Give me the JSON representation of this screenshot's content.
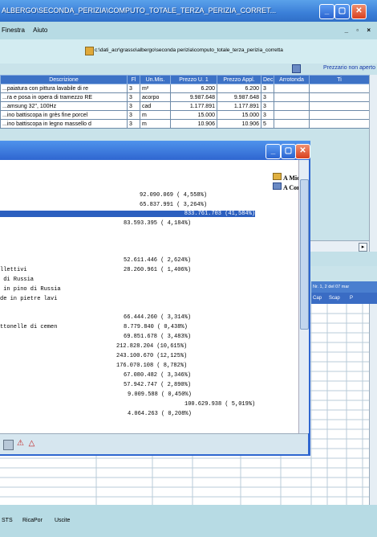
{
  "window": {
    "title": "ALBERGO\\SECONDA_PERIZIA\\COMPUTO_TOTALE_TERZA_PERIZIA_CORRET...",
    "min_label": "_",
    "max_label": "▢",
    "close_label": "✕"
  },
  "menu": {
    "items": [
      "Finestra",
      "Aiuto"
    ],
    "mdi_controls": "_ ▫ ×"
  },
  "path": "c:\\dati_acr\\grasso\\albergo\\seconda perizia\\computo_totale_terza_perizia_corretta",
  "link": "Prezzario non aperto",
  "table": {
    "headers": [
      "Descrizione",
      "Fl",
      "Un.Mis.",
      "Prezzo U. 1",
      "Prezzo Appl.",
      "Dec",
      "Arrotonda",
      "Ti"
    ],
    "rows": [
      [
        "...paiatura con pittura lavabile di re",
        "3",
        "m²",
        "6.200",
        "6.200",
        "3",
        "",
        ""
      ],
      [
        "...ra e posa in opera di tramezzo RE",
        "3",
        "acorpo",
        "9.987.648",
        "9.987.648",
        "3",
        "",
        ""
      ],
      [
        "...amsung 32\", 100Hz",
        "3",
        "cad",
        "1.177.891",
        "1.177.891",
        "3",
        "",
        ""
      ],
      [
        "...ino battiscopa in grès fine porcel",
        "3",
        "m",
        "15.000",
        "15.000",
        "3",
        "",
        ""
      ],
      [
        "...ino battiscopa in legno massello d",
        "3",
        "m",
        "10.906",
        "10.906",
        "5",
        "",
        ""
      ]
    ]
  },
  "popup": {
    "side_items": [
      "A Mico",
      "A Com"
    ],
    "lines": [
      {
        "label": "",
        "value": "92.090.069 ( 4,558%)"
      },
      {
        "label": "",
        "value": "65.837.991 ( 3,264%)"
      },
      {
        "label": "",
        "value": "833.761.703 (41,584%)",
        "selected": true
      },
      {
        "label": "",
        "value": "83.593.395 ( 4,184%)"
      },
      {
        "label": "",
        "value": ""
      },
      {
        "label": "",
        "value": ""
      },
      {
        "label": "",
        "value": "52.611.446 ( 2,624%)"
      },
      {
        "label": "llettivi",
        "value": "28.260.961 ( 1,406%)"
      },
      {
        "label": " di Russia",
        "value": ""
      },
      {
        "label": " in pino di Russia",
        "value": ""
      },
      {
        "label": "de in pietre lavi",
        "value": ""
      },
      {
        "label": "",
        "value": ""
      },
      {
        "label": "",
        "value": "66.444.260 ( 3,314%)"
      },
      {
        "label": "ttonelle di cemen",
        "value": "8.779.840 ( 0,438%)"
      },
      {
        "label": "",
        "value": "69.851.678 ( 3,483%)"
      },
      {
        "label": "",
        "value": "212.828.204 (10,615%)"
      },
      {
        "label": "",
        "value": "243.100.670 (12,125%)"
      },
      {
        "label": "",
        "value": "176.070.108 ( 8,782%)"
      },
      {
        "label": "",
        "value": "67.080.482 ( 3,346%)"
      },
      {
        "label": "",
        "value": "57.942.747 ( 2,890%)"
      },
      {
        "label": "",
        "value": "9.009.588 ( 0,450%)"
      },
      {
        "label": "",
        "value": "100.629.938 ( 5,019%)"
      },
      {
        "label": "",
        "value": "4.064.263 ( 0,208%)"
      }
    ]
  },
  "lower_header_text": "Nr. 1, 2 del 07 mar",
  "lower_columns": [
    "Cap",
    "Scap",
    "P"
  ],
  "status": {
    "items": [
      "STS",
      "RicaPor",
      "Uscite"
    ]
  },
  "colors": {
    "titlebar": "#3b7fd8",
    "grid_header": "#3d72c6",
    "selected": "#2c5fbf"
  }
}
